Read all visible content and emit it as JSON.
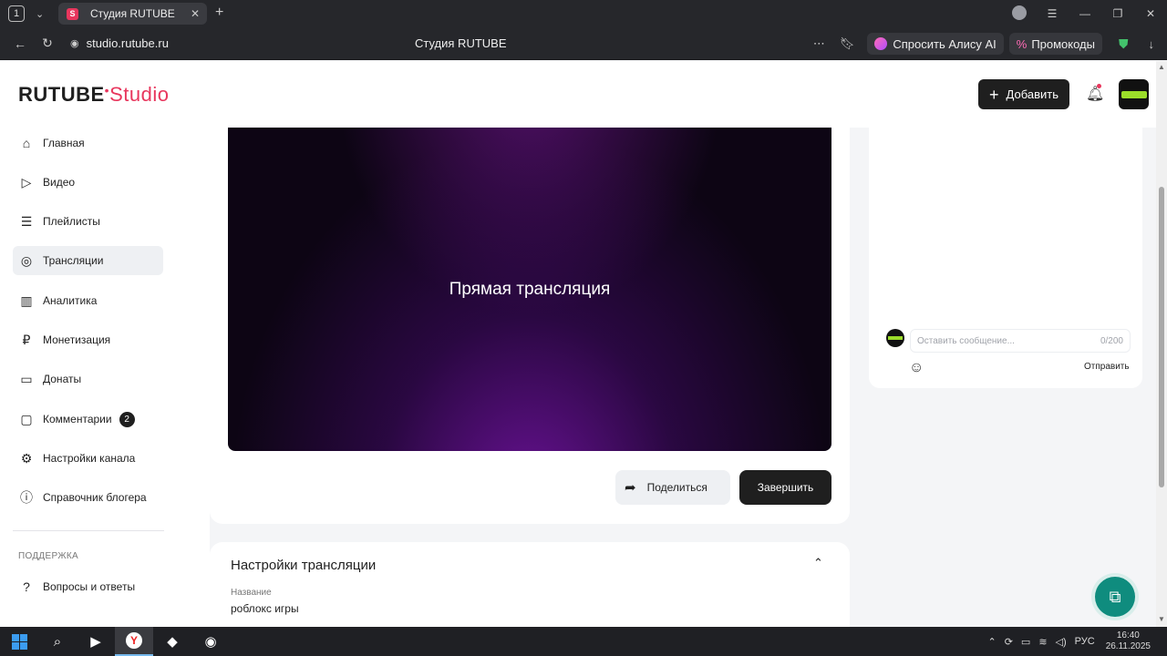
{
  "browser": {
    "tab_counter": "1",
    "tab_title": "Студия RUTUBE",
    "tab_favicon": "S",
    "url": "studio.rutube.ru",
    "page_title": "Студия RUTUBE",
    "alisa_label": "Спросить Алису AI",
    "promo_label": "Промокоды"
  },
  "header": {
    "logo_main": "RUTUBE",
    "logo_studio": "Studio",
    "add_label": "Добавить"
  },
  "sidebar": {
    "items": [
      {
        "label": "Главная",
        "icon": "home-icon"
      },
      {
        "label": "Видео",
        "icon": "video-icon"
      },
      {
        "label": "Плейлисты",
        "icon": "playlist-icon"
      },
      {
        "label": "Трансляции",
        "icon": "broadcast-icon"
      },
      {
        "label": "Аналитика",
        "icon": "analytics-icon"
      },
      {
        "label": "Монетизация",
        "icon": "ruble-icon"
      },
      {
        "label": "Донаты",
        "icon": "wallet-icon"
      },
      {
        "label": "Комментарии",
        "icon": "comment-icon",
        "badge": "2"
      },
      {
        "label": "Настройки канала",
        "icon": "gear-icon"
      },
      {
        "label": "Справочник блогера",
        "icon": "info-icon"
      }
    ],
    "section_support": "ПОДДЕРЖКА",
    "support_items": [
      {
        "label": "Вопросы и ответы",
        "icon": "chat-question-icon"
      }
    ]
  },
  "player": {
    "label": "Прямая трансляция"
  },
  "actions": {
    "share_label": "Поделиться",
    "end_label": "Завершить"
  },
  "settings": {
    "title": "Настройки трансляции",
    "name_label": "Название",
    "name_value": "роблокс игры"
  },
  "chat": {
    "placeholder": "Оставить сообщение...",
    "counter": "0/200",
    "send_label": "Отправить"
  },
  "taskbar": {
    "lang": "РУС",
    "time": "16:40",
    "date": "26.11.2025"
  },
  "colors": {
    "brand": "#e8365d",
    "dark": "#1f1f1f",
    "helper": "#0f8c7e"
  }
}
